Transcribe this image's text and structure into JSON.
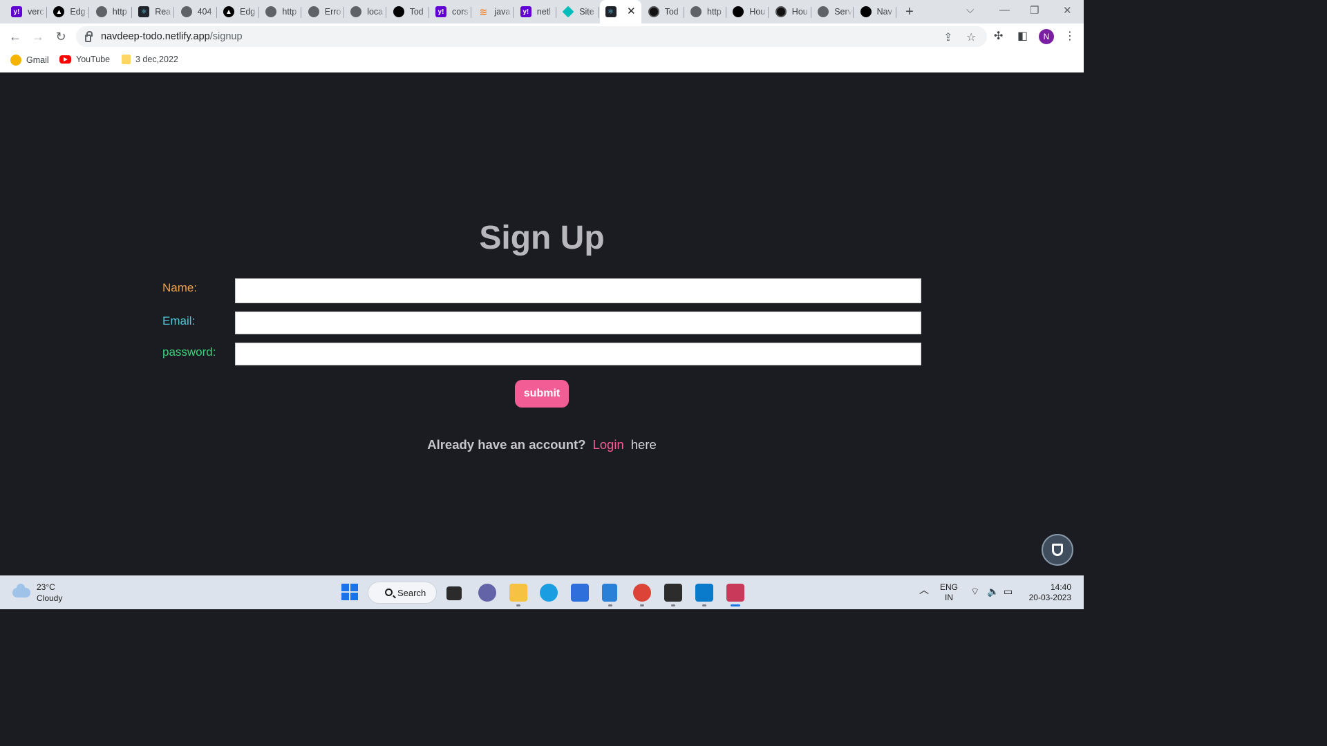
{
  "browser": {
    "tabs": [
      {
        "title": "verc",
        "icon": "yahoo-icon"
      },
      {
        "title": "Edg",
        "icon": "triangle-icon"
      },
      {
        "title": "http",
        "icon": "globe-icon"
      },
      {
        "title": "Rea",
        "icon": "react-icon"
      },
      {
        "title": "404",
        "icon": "globe-icon"
      },
      {
        "title": "Edg",
        "icon": "triangle-icon"
      },
      {
        "title": "http",
        "icon": "globe-icon"
      },
      {
        "title": "Erro",
        "icon": "globe-icon"
      },
      {
        "title": "loca",
        "icon": "globe-icon"
      },
      {
        "title": "Tod",
        "icon": "github-icon"
      },
      {
        "title": "cors",
        "icon": "yahoo-icon"
      },
      {
        "title": "java",
        "icon": "stackoverflow-icon"
      },
      {
        "title": "netl",
        "icon": "yahoo-icon"
      },
      {
        "title": "Site",
        "icon": "netlify-icon"
      },
      {
        "title": "",
        "icon": "react-icon",
        "active": true
      },
      {
        "title": "Tod",
        "icon": "dark-circle-icon"
      },
      {
        "title": "http",
        "icon": "globe-icon"
      },
      {
        "title": "Hou",
        "icon": "github-icon"
      },
      {
        "title": "Hou",
        "icon": "dark-circle-icon"
      },
      {
        "title": "Serv",
        "icon": "globe-icon"
      },
      {
        "title": "Nav",
        "icon": "github-icon"
      }
    ],
    "new_tab_label": "+",
    "url_host": "navdeep-todo.netlify.app",
    "url_path": "/signup",
    "profile_initial": "N",
    "bookmarks": [
      {
        "label": "Gmail",
        "icon": "gmail-icon"
      },
      {
        "label": "YouTube",
        "icon": "youtube-icon"
      },
      {
        "label": "3 dec,2022",
        "icon": "folder-icon"
      }
    ]
  },
  "signup": {
    "title": "Sign Up",
    "fields": [
      {
        "label": "Name:",
        "value": "",
        "color": "#f0a04b"
      },
      {
        "label": "Email:",
        "value": "",
        "color": "#4ec9d6"
      },
      {
        "label": "password:",
        "value": "",
        "color": "#3ecf7a"
      }
    ],
    "submit_label": "submit",
    "have_account_text": "Already have an account?",
    "login_link": "Login",
    "here_text": "here",
    "accent_color": "#f25d96"
  },
  "taskbar": {
    "weather_temp": "23°C",
    "weather_desc": "Cloudy",
    "search_label": "Search",
    "lang_line1": "ENG",
    "lang_line2": "IN",
    "time": "14:40",
    "date": "20-03-2023"
  }
}
